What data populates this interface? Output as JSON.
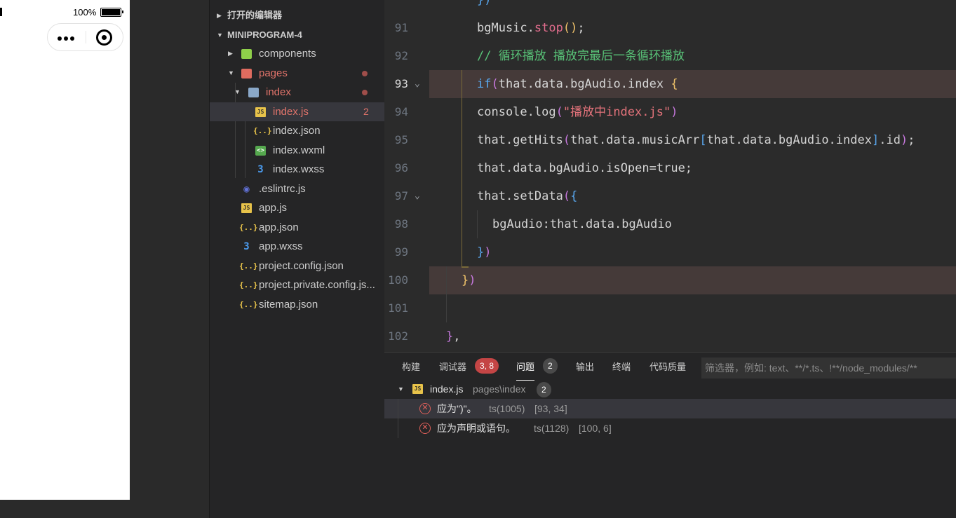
{
  "simulator": {
    "battery_percent": "100%"
  },
  "explorer": {
    "open_editors_label": "打开的编辑器",
    "project_name": "MINIPROGRAM-4",
    "items": [
      {
        "name": "components",
        "icon": "folder-components-icon"
      },
      {
        "name": "pages",
        "icon": "folder-pages-icon"
      },
      {
        "name": "index",
        "icon": "folder-open-icon"
      },
      {
        "name": "index.js",
        "icon": "js-file-icon",
        "problems": "2"
      },
      {
        "name": "index.json",
        "icon": "json-file-icon"
      },
      {
        "name": "index.wxml",
        "icon": "wxml-file-icon"
      },
      {
        "name": "index.wxss",
        "icon": "wxss-file-icon"
      },
      {
        "name": ".eslintrc.js",
        "icon": "eslint-file-icon"
      },
      {
        "name": "app.js",
        "icon": "js-file-icon"
      },
      {
        "name": "app.json",
        "icon": "json-file-icon"
      },
      {
        "name": "app.wxss",
        "icon": "wxss-file-icon"
      },
      {
        "name": "project.config.json",
        "icon": "json-file-icon"
      },
      {
        "name": "project.private.config.js...",
        "icon": "json-file-icon"
      },
      {
        "name": "sitemap.json",
        "icon": "json-file-icon"
      }
    ]
  },
  "editor": {
    "top_partial": "})",
    "lines": [
      {
        "n": "91",
        "tokens": [
          [
            "plain",
            "bgMusic."
          ],
          [
            "fn",
            "stop"
          ],
          [
            "br1",
            "()"
          ],
          [
            "plain",
            ";"
          ]
        ]
      },
      {
        "n": "92",
        "tokens": [
          [
            "cm",
            "// 循环播放 播放完最后一条循环播放"
          ]
        ]
      },
      {
        "n": "93",
        "tokens": [
          [
            "kw",
            "if"
          ],
          [
            "br2",
            "("
          ],
          [
            "plain",
            "that.data.bgAudio.index "
          ],
          [
            "br1",
            "{"
          ]
        ]
      },
      {
        "n": "94",
        "tokens": [
          [
            "plain",
            "console.log"
          ],
          [
            "br2",
            "("
          ],
          [
            "str",
            "\"播放中index.js\""
          ],
          [
            "br2",
            ")"
          ]
        ]
      },
      {
        "n": "95",
        "tokens": [
          [
            "plain",
            "that.getHits"
          ],
          [
            "br2",
            "("
          ],
          [
            "plain",
            "that.data.musicArr"
          ],
          [
            "br3",
            "["
          ],
          [
            "plain",
            "that.data.bgAudio.index"
          ],
          [
            "br3",
            "]"
          ],
          [
            "plain",
            ".id"
          ],
          [
            "br2",
            ")"
          ],
          [
            "plain",
            ";"
          ]
        ]
      },
      {
        "n": "96",
        "tokens": [
          [
            "plain",
            "that.data.bgAudio.isOpen=true;"
          ]
        ]
      },
      {
        "n": "97",
        "tokens": [
          [
            "plain",
            "that.setData"
          ],
          [
            "br2",
            "("
          ],
          [
            "br3",
            "{"
          ]
        ]
      },
      {
        "n": "98",
        "tokens": [
          [
            "plain",
            "bgAudio:that.data.bgAudio"
          ]
        ]
      },
      {
        "n": "99",
        "tokens": [
          [
            "br3",
            "}"
          ],
          [
            "br2",
            ")"
          ]
        ]
      },
      {
        "n": "100",
        "tokens": [
          [
            "br1",
            "}"
          ],
          [
            "br2",
            ")"
          ]
        ]
      },
      {
        "n": "101",
        "tokens": []
      },
      {
        "n": "102",
        "tokens": [
          [
            "br2",
            "}"
          ],
          [
            "plain",
            ","
          ]
        ]
      }
    ]
  },
  "panel": {
    "tabs": [
      {
        "label": "构建"
      },
      {
        "label": "调试器",
        "badge": "3, 8"
      },
      {
        "label": "问题",
        "badge": "2"
      },
      {
        "label": "输出"
      },
      {
        "label": "终端"
      },
      {
        "label": "代码质量"
      }
    ],
    "filter_placeholder": "筛选器，例如: text、**/*.ts、!**/node_modules/**",
    "problems": {
      "file": "index.js",
      "path": "pages\\index",
      "count": "2",
      "items": [
        {
          "message": "应为\")\"。",
          "code": "ts(1005)",
          "position": "[93, 34]"
        },
        {
          "message": "应为声明或语句。",
          "code": "ts(1128)",
          "position": "[100, 6]"
        }
      ]
    }
  },
  "colors": {
    "editor_bg": "#2b2b2b",
    "sidebar_bg": "#252526",
    "error_red": "#e0605a",
    "comment_green": "#58c277",
    "function_pink": "#e06c8c"
  }
}
